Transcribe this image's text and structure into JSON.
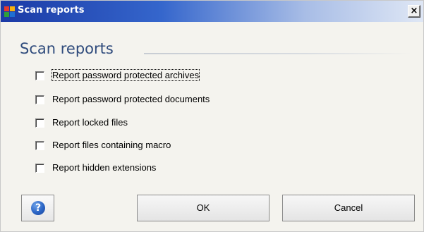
{
  "window": {
    "title": "Scan reports",
    "close_label": "×"
  },
  "main": {
    "heading": "Scan reports",
    "options": [
      {
        "label": "Report password protected archives",
        "checked": false,
        "focused": true
      },
      {
        "label": "Report password protected documents",
        "checked": false,
        "focused": false
      },
      {
        "label": "Report locked files",
        "checked": false,
        "focused": false
      },
      {
        "label": "Report files containing macro",
        "checked": false,
        "focused": false
      },
      {
        "label": "Report hidden extensions",
        "checked": false,
        "focused": false
      }
    ]
  },
  "footer": {
    "help_icon": "help-icon",
    "help_glyph": "?",
    "ok_label": "OK",
    "cancel_label": "Cancel"
  },
  "colors": {
    "heading": "#2f4b7c",
    "titlebar_start": "#1b3aa6",
    "titlebar_end": "#dfe7f5"
  }
}
